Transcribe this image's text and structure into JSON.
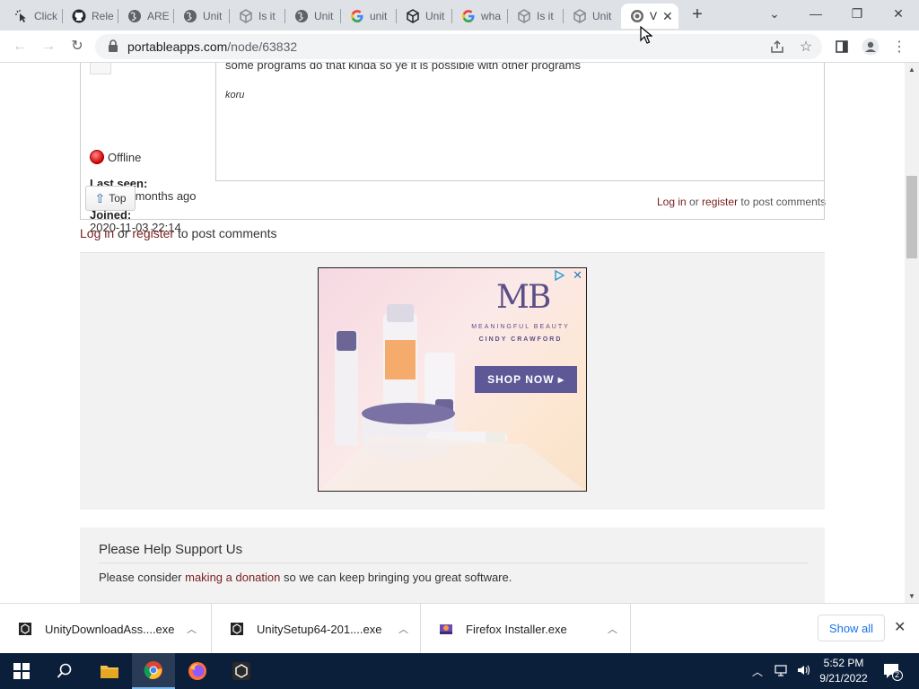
{
  "browser": {
    "tabs": [
      {
        "label": "Click",
        "icon": "cursor-sparkle-icon"
      },
      {
        "label": "Rele",
        "icon": "github-icon"
      },
      {
        "label": "ARE",
        "icon": "globe-icon"
      },
      {
        "label": "Unit",
        "icon": "globe-icon"
      },
      {
        "label": "Is it",
        "icon": "unity-icon"
      },
      {
        "label": "Unit",
        "icon": "globe-icon"
      },
      {
        "label": "unit",
        "icon": "google-icon"
      },
      {
        "label": "Unit",
        "icon": "unity-icon"
      },
      {
        "label": "wha",
        "icon": "google-icon"
      },
      {
        "label": "Is it",
        "icon": "unity-icon"
      },
      {
        "label": "Unit",
        "icon": "unity-icon"
      },
      {
        "label": "V",
        "icon": "portableapps-icon"
      }
    ],
    "address": {
      "host": "portableapps.com",
      "path": "/node/63832"
    }
  },
  "comment": {
    "body_text": "some programs do that kinda so ye it is possible with other programs",
    "signature": "koru",
    "status": "Offline",
    "last_seen_label": "Last seen:",
    "last_seen_value": "1 year 5 months ago",
    "joined_label": "Joined:",
    "joined_value": "2020-11-03 22:14",
    "top_button": "Top",
    "box_login": "Log in",
    "box_or": " or ",
    "box_register": "register",
    "box_suffix": " to post comments"
  },
  "page_login": {
    "login": "Log in",
    "or": " or ",
    "register": "register",
    "suffix": " to post comments"
  },
  "ad": {
    "logo": "MB",
    "brand_line1": "MEANINGFUL BEAUTY",
    "brand_line2": "CINDY CRAWFORD",
    "cta": "SHOP NOW ▸"
  },
  "support": {
    "title": "Please Help Support Us",
    "before": "Please consider ",
    "link": "making a donation",
    "after": " so we can keep bringing you great software."
  },
  "downloads": {
    "items": [
      {
        "name": "UnityDownloadAss....exe"
      },
      {
        "name": "UnitySetup64-201....exe"
      },
      {
        "name": "Firefox Installer.exe"
      }
    ],
    "show_all": "Show all"
  },
  "taskbar": {
    "time": "5:52 PM",
    "date": "9/21/2022",
    "notification_count": "2"
  }
}
